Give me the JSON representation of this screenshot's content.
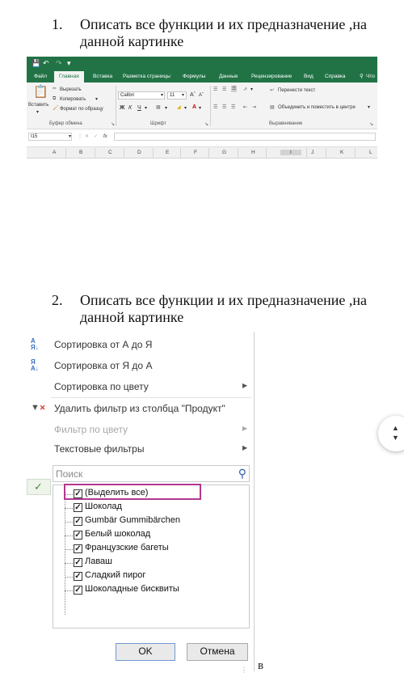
{
  "task1": {
    "number": "1.",
    "text": "Описать все функции и их предназначение ,на данной картинке"
  },
  "task2": {
    "number": "2.",
    "text": "Описать все функции и их предназначение ,на данной картинке"
  },
  "excel": {
    "tabs": [
      "Файл",
      "Главная",
      "Вставка",
      "Разметка страницы",
      "Формулы",
      "Данные",
      "Рецензирование",
      "Вид",
      "Справка",
      "Что"
    ],
    "active_tab": "Главная",
    "clipboard": {
      "paste": "Вставить",
      "cut": "Вырезать",
      "copy": "Копировать",
      "format_painter": "Формат по образцу",
      "group": "Буфер обмена"
    },
    "font": {
      "name": "Calibri",
      "size": "11",
      "bold": "Ж",
      "italic": "К",
      "underline": "Ч",
      "group": "Шрифт"
    },
    "alignment": {
      "wrap_text": "Перенести текст",
      "merge_center": "Объединить и поместить в центре",
      "group": "Выравнивание"
    },
    "name_box": "I15",
    "fx": "fx",
    "columns": [
      "A",
      "B",
      "C",
      "D",
      "E",
      "F",
      "G",
      "H",
      "I",
      "J",
      "K",
      "L"
    ],
    "accent_color": "#217346"
  },
  "filter_menu": {
    "sort_az": "Сортировка от А до Я",
    "sort_za": "Сортировка от Я до А",
    "sort_color": "Сортировка по цвету",
    "clear_filter": "Удалить фильтр из столбца \"Продукт\"",
    "filter_color": "Фильтр по цвету",
    "text_filters": "Текстовые фильтры",
    "search_placeholder": "Поиск",
    "items": [
      {
        "label": "(Выделить все)",
        "checked": true
      },
      {
        "label": "Шоколад",
        "checked": true
      },
      {
        "label": "Gumbär Gummibärchen",
        "checked": true
      },
      {
        "label": "Белый шоколад",
        "checked": true
      },
      {
        "label": "Французские багеты",
        "checked": true
      },
      {
        "label": "Лаваш",
        "checked": true
      },
      {
        "label": "Сладкий пирог",
        "checked": true
      },
      {
        "label": "Шоколадные бисквиты",
        "checked": true
      }
    ],
    "ok": "OK",
    "cancel": "Отмена",
    "highlight_color": "#b3388e"
  },
  "stray_text": "в"
}
